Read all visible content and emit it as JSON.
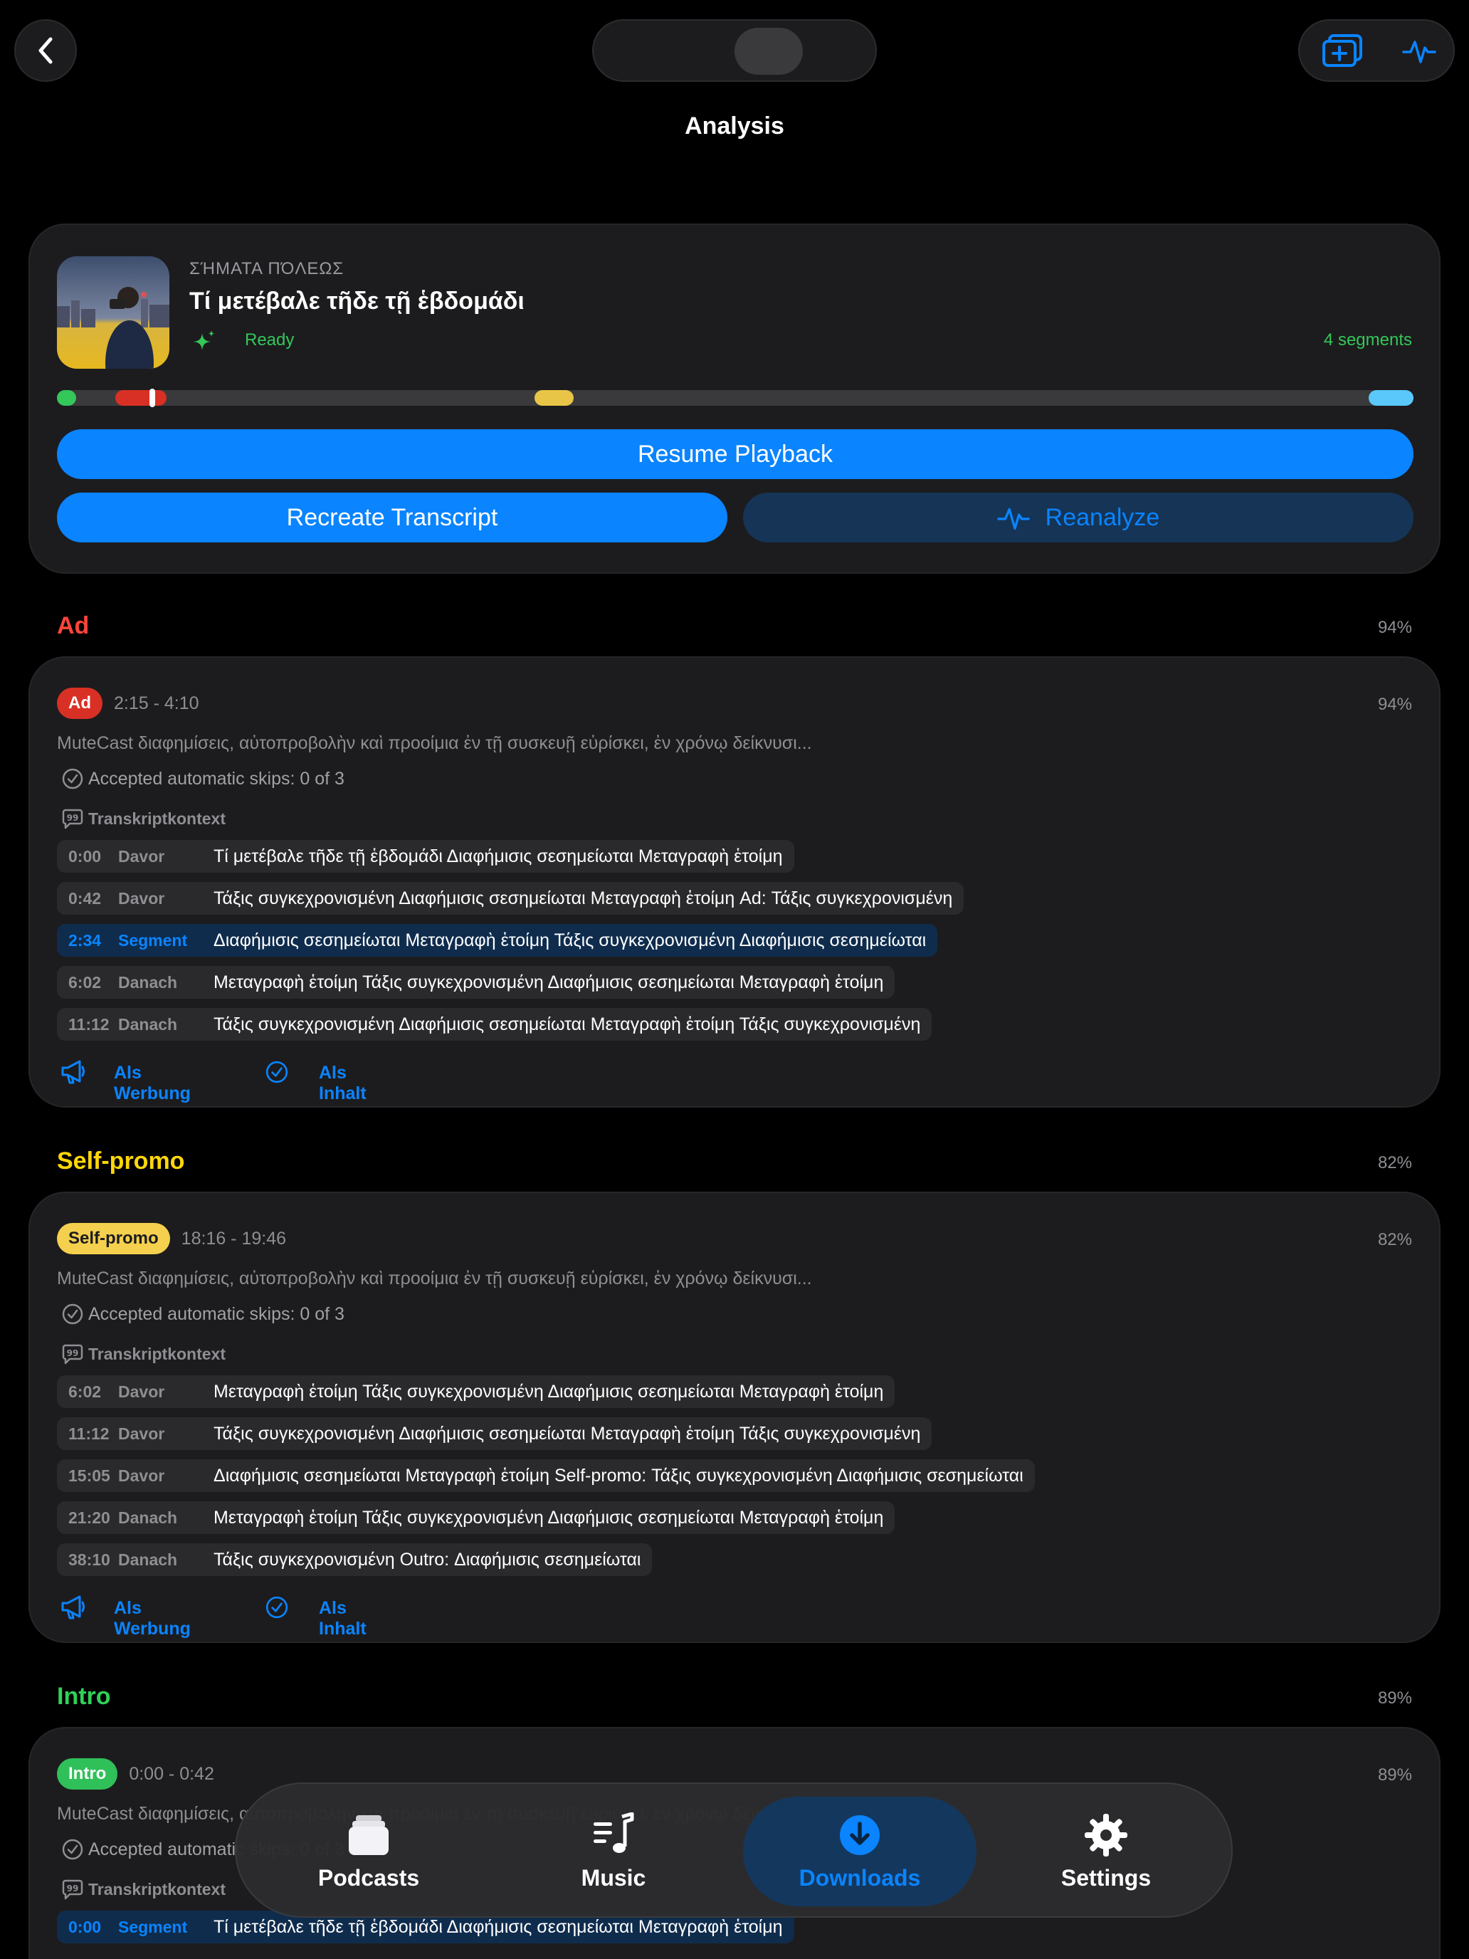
{
  "nav": {
    "title": "Analysis"
  },
  "episode": {
    "show": "ΣΉΜΑΤΑ ΠΌΛΕΩΣ",
    "title": "Τί μετέβαλε τῆδε τῇ ἑβδομάδι",
    "status": "Ready",
    "segment_count": "4 segments",
    "timeline_segments": [
      {
        "type": "intro",
        "start": 0.0,
        "end": 0.014,
        "color": "#34c759"
      },
      {
        "type": "ad",
        "start": 0.043,
        "end": 0.081,
        "color": "#d93025"
      },
      {
        "type": "self-promo",
        "start": 0.352,
        "end": 0.381,
        "color": "#e8c547"
      },
      {
        "type": "outro",
        "start": 0.967,
        "end": 1.0,
        "color": "#5ac8fa"
      }
    ],
    "playhead": 0.068,
    "resume_label": "Resume Playback",
    "recreate_label": "Recreate Transcript",
    "reanalyze_label": "Reanalyze"
  },
  "sections": [
    {
      "title": "Ad",
      "color": "#ff453a",
      "percent": "94%",
      "badge": "Ad",
      "badge_bg": "#d93025",
      "badge_fg": "#ffffff",
      "time_range": "2:15 - 4:10",
      "description": "MuteCast διαφημίσεις, αὐτοπροβολὴν καὶ προοίμια ἐν τῇ συσκευῇ εὑρίσκει, ἐν χρόνῳ δείκνυσι...",
      "accepted": "Accepted automatic skips: 0 of 3",
      "context_label": "Transkriptkontext",
      "rows": [
        {
          "time": "0:00",
          "speaker": "Davor",
          "text": "Τί μετέβαλε τῆδε τῇ ἑβδομάδι Διαφήμισις σεσημείωται Μεταγραφὴ ἑτοίμη",
          "hl": false
        },
        {
          "time": "0:42",
          "speaker": "Davor",
          "text": "Τάξις συγκεχρονισμένη Διαφήμισις σεσημείωται Μεταγραφὴ ἑτοίμη Ad: Τάξις συγκεχρονισμένη",
          "hl": false
        },
        {
          "time": "2:34",
          "speaker": "Segment",
          "text": "Διαφήμισις σεσημείωται Μεταγραφὴ ἑτοίμη Τάξις συγκεχρονισμένη Διαφήμισις σεσημείωται",
          "hl": true
        },
        {
          "time": "6:02",
          "speaker": "Danach",
          "text": "Μεταγραφὴ ἑτοίμη Τάξις συγκεχρονισμένη Διαφήμισις σεσημείωται Μεταγραφὴ ἑτοίμη",
          "hl": false
        },
        {
          "time": "11:12",
          "speaker": "Danach",
          "text": "Τάξις συγκεχρονισμένη Διαφήμισις σεσημείωται Μεταγραφὴ ἑτοίμη Τάξις συγκεχρονισμένη",
          "hl": false
        }
      ],
      "mark_ad_label": "Als Werbung",
      "mark_content_label": "Als Inhalt"
    },
    {
      "title": "Self-promo",
      "color": "#ffd60a",
      "percent": "82%",
      "badge": "Self-promo",
      "badge_bg": "#f5d04e",
      "badge_fg": "#1c1c1e",
      "time_range": "18:16 - 19:46",
      "description": "MuteCast διαφημίσεις, αὐτοπροβολὴν καὶ προοίμια ἐν τῇ συσκευῇ εὑρίσκει, ἐν χρόνῳ δείκνυσι...",
      "accepted": "Accepted automatic skips: 0 of 3",
      "context_label": "Transkriptkontext",
      "rows": [
        {
          "time": "6:02",
          "speaker": "Davor",
          "text": "Μεταγραφὴ ἑτοίμη Τάξις συγκεχρονισμένη Διαφήμισις σεσημείωται Μεταγραφὴ ἑτοίμη",
          "hl": false
        },
        {
          "time": "11:12",
          "speaker": "Davor",
          "text": "Τάξις συγκεχρονισμένη Διαφήμισις σεσημείωται Μεταγραφὴ ἑτοίμη Τάξις συγκεχρονισμένη",
          "hl": false
        },
        {
          "time": "15:05",
          "speaker": "Davor",
          "text": "Διαφήμισις σεσημείωται Μεταγραφὴ ἑτοίμη Self-promo: Τάξις συγκεχρονισμένη Διαφήμισις σεσημείωται",
          "hl": false
        },
        {
          "time": "21:20",
          "speaker": "Danach",
          "text": "Μεταγραφὴ ἑτοίμη Τάξις συγκεχρονισμένη Διαφήμισις σεσημείωται Μεταγραφὴ ἑτοίμη",
          "hl": false
        },
        {
          "time": "38:10",
          "speaker": "Danach",
          "text": "Τάξις συγκεχρονισμένη Outro: Διαφήμισις σεσημείωται",
          "hl": false
        }
      ],
      "mark_ad_label": "Als Werbung",
      "mark_content_label": "Als Inhalt"
    },
    {
      "title": "Intro",
      "color": "#30d158",
      "percent": "89%",
      "badge": "Intro",
      "badge_bg": "#30c05a",
      "badge_fg": "#ffffff",
      "time_range": "0:00 - 0:42",
      "description": "MuteCast διαφημίσεις, αὐτοπροβολὴν καὶ προοίμια ἐν τῇ συσκευῇ εὑρίσκει, ἐν χρόνῳ δείκνυσι...",
      "accepted": "Accepted automatic skips: 0 of 3",
      "context_label": "Transkriptkontext",
      "rows": [
        {
          "time": "0:00",
          "speaker": "Segment",
          "text": "Τί μετέβαλε τῆδε τῇ ἑβδομάδι Διαφήμισις σεσημείωται Μεταγραφὴ ἑτοίμη",
          "hl": true
        }
      ]
    }
  ],
  "tabs": [
    {
      "label": "Podcasts",
      "icon": "podcasts-stack-icon",
      "active": false
    },
    {
      "label": "Music",
      "icon": "music-note-icon",
      "active": false
    },
    {
      "label": "Downloads",
      "icon": "download-circle-icon",
      "active": true
    },
    {
      "label": "Settings",
      "icon": "gear-icon",
      "active": false
    }
  ]
}
